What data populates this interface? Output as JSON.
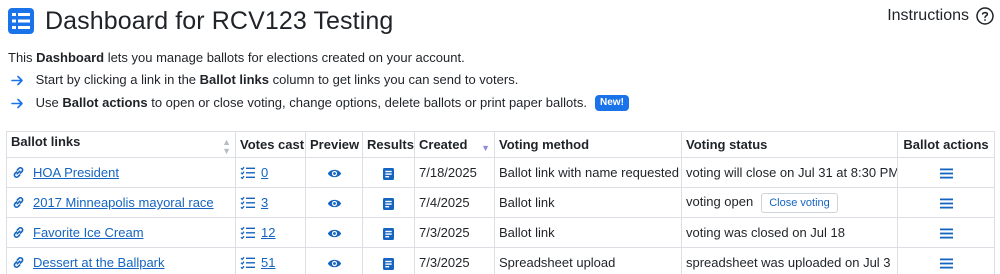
{
  "header": {
    "title": "Dashboard for RCV123 Testing",
    "instructions_label": "Instructions"
  },
  "intro": {
    "prefix": "This ",
    "bold": "Dashboard",
    "suffix": " lets you manage ballots for elections created on your account."
  },
  "bullets": [
    {
      "prefix": "Start by clicking a link in the ",
      "bold": "Ballot links",
      "suffix": " column to get links you can send to voters."
    },
    {
      "prefix": "Use ",
      "bold": "Ballot actions",
      "suffix": " to open or close voting, change options, delete ballots or print paper ballots.",
      "badge": "New!"
    }
  ],
  "table": {
    "columns": [
      "Ballot links",
      "Votes cast",
      "Preview",
      "Results",
      "Created",
      "Voting method",
      "Voting status",
      "Ballot actions"
    ],
    "rows": [
      {
        "name": "HOA President",
        "votes": "0",
        "created": "7/18/2025",
        "method": "Ballot link with name requested",
        "status": "voting will close on Jul 31 at 8:30 PM",
        "action_button": ""
      },
      {
        "name": "2017 Minneapolis mayoral race",
        "votes": "3",
        "created": "7/4/2025",
        "method": "Ballot link",
        "status": "voting open",
        "action_button": "Close voting"
      },
      {
        "name": "Favorite Ice Cream",
        "votes": "12",
        "created": "7/3/2025",
        "method": "Ballot link",
        "status": "voting was closed on Jul 18",
        "action_button": ""
      },
      {
        "name": "Dessert at the Ballpark",
        "votes": "51",
        "created": "7/3/2025",
        "method": "Spreadsheet upload",
        "status": "spreadsheet was uploaded on Jul 3",
        "action_button": ""
      }
    ]
  },
  "icons": {
    "title": "list-box-icon",
    "instructions": "question-circle-icon",
    "bullet": "arrow-right-icon",
    "ballot_link": "link-chain-icon",
    "votes": "checklist-icon",
    "preview": "eye-icon",
    "results": "results-doc-icon",
    "actions": "hamburger-menu-icon"
  },
  "colors": {
    "accent": "#1a73e8",
    "link": "#1565c0",
    "text": "#1f2328",
    "border": "#dcdfe3"
  }
}
